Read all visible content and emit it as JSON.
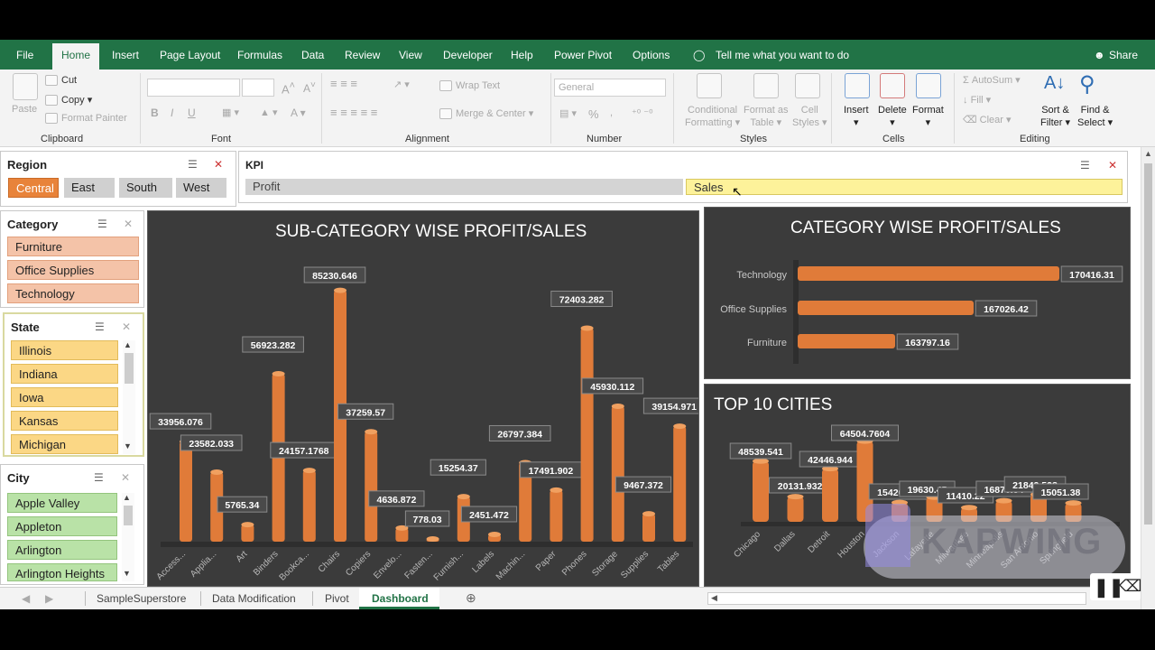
{
  "ribbon_tabs": [
    "File",
    "Home",
    "Insert",
    "Page Layout",
    "Formulas",
    "Data",
    "Review",
    "View",
    "Developer",
    "Help",
    "Power Pivot",
    "Options"
  ],
  "tell_me": "Tell me what you want to do",
  "share": "Share",
  "clipboard": {
    "paste": "Paste",
    "cut": "Cut",
    "copy": "Copy",
    "format_painter": "Format Painter",
    "group": "Clipboard"
  },
  "font": {
    "bold": "B",
    "italic": "I",
    "underline": "U",
    "group": "Font"
  },
  "alignment": {
    "wrap": "Wrap Text",
    "merge": "Merge & Center",
    "group": "Alignment"
  },
  "number": {
    "format": "General",
    "percent": "%",
    "group": "Number"
  },
  "styles": {
    "conditional": "Conditional",
    "formatting": "Formatting",
    "format_as": "Format as",
    "table": "Table",
    "cell": "Cell",
    "cell_styles": "Styles",
    "group": "Styles"
  },
  "cells": {
    "insert": "Insert",
    "delete": "Delete",
    "format": "Format",
    "group": "Cells"
  },
  "editing": {
    "autosum": "AutoSum",
    "fill": "Fill",
    "clear": "Clear",
    "sort": "Sort &",
    "filter": "Filter",
    "find": "Find &",
    "select": "Select",
    "group": "Editing"
  },
  "region_slicer": {
    "title": "Region",
    "items": [
      "Central",
      "East",
      "South",
      "West"
    ]
  },
  "kpi_slicer": {
    "title": "KPI",
    "items": [
      "Profit",
      "Sales"
    ]
  },
  "category_slicer": {
    "title": "Category",
    "items": [
      "Furniture",
      "Office Supplies",
      "Technology"
    ]
  },
  "state_slicer": {
    "title": "State",
    "items": [
      "Illinois",
      "Indiana",
      "Iowa",
      "Kansas",
      "Michigan"
    ]
  },
  "city_slicer": {
    "title": "City",
    "items": [
      "Apple Valley",
      "Appleton",
      "Arlington",
      "Arlington Heights"
    ]
  },
  "colors": {
    "ribbon_green": "#217346",
    "bar_orange": "#e07b39",
    "panel_bg": "#3b3b3b",
    "region_selected": "#e8833a",
    "category_item": "#f4c3a8",
    "state_item": "#fbd785",
    "city_item": "#b9e2a7",
    "kpi_sales": "#fdf29a"
  },
  "charts": {
    "subcategory_title": "SUB-CATEGORY WISE PROFIT/SALES",
    "category_title": "CATEGORY WISE PROFIT/SALES",
    "cities_title": "TOP 10 CITIES"
  },
  "chart_data": [
    {
      "type": "bar",
      "title": "SUB-CATEGORY WISE PROFIT/SALES",
      "categories": [
        "Access...",
        "Applia...",
        "Art",
        "Binders",
        "Bookca...",
        "Chairs",
        "Copiers",
        "Envelo...",
        "Fasten...",
        "Furnish...",
        "Labels",
        "Machin...",
        "Paper",
        "Phones",
        "Storage",
        "Supplies",
        "Tables"
      ],
      "values": [
        33956.076,
        23582.033,
        5765.34,
        56923.282,
        24157.1768,
        85230.646,
        37259.57,
        4636.872,
        778.03,
        15254.37,
        2451.472,
        26797.384,
        17491.902,
        72403.282,
        45930.112,
        9467.372,
        39154.971
      ],
      "ylim": [
        0,
        90000
      ]
    },
    {
      "type": "bar",
      "title": "CATEGORY WISE PROFIT/SALES",
      "orientation": "horizontal",
      "categories": [
        "Technology",
        "Office Supplies",
        "Furniture"
      ],
      "values": [
        170416.31,
        167026.42,
        163797.16
      ]
    },
    {
      "type": "bar",
      "title": "TOP 10 CITIES",
      "categories": [
        "Chicago",
        "Dallas",
        "Detroit",
        "Houston",
        "Jackson",
        "Lafayette",
        "Milwaukee",
        "Minneapolis",
        "San Antonio",
        "Springfield"
      ],
      "values": [
        48539.541,
        20131.9322,
        42446.944,
        64504.7604,
        15420.036,
        19630.45,
        11410.22,
        16870.54,
        21843.528,
        15051.38
      ],
      "ylim": [
        0,
        70000
      ]
    }
  ],
  "watermark": "KAPWING",
  "sheet_tabs": [
    "SampleSuperstore",
    "Data Modification",
    "Pivot",
    "Dashboard"
  ]
}
